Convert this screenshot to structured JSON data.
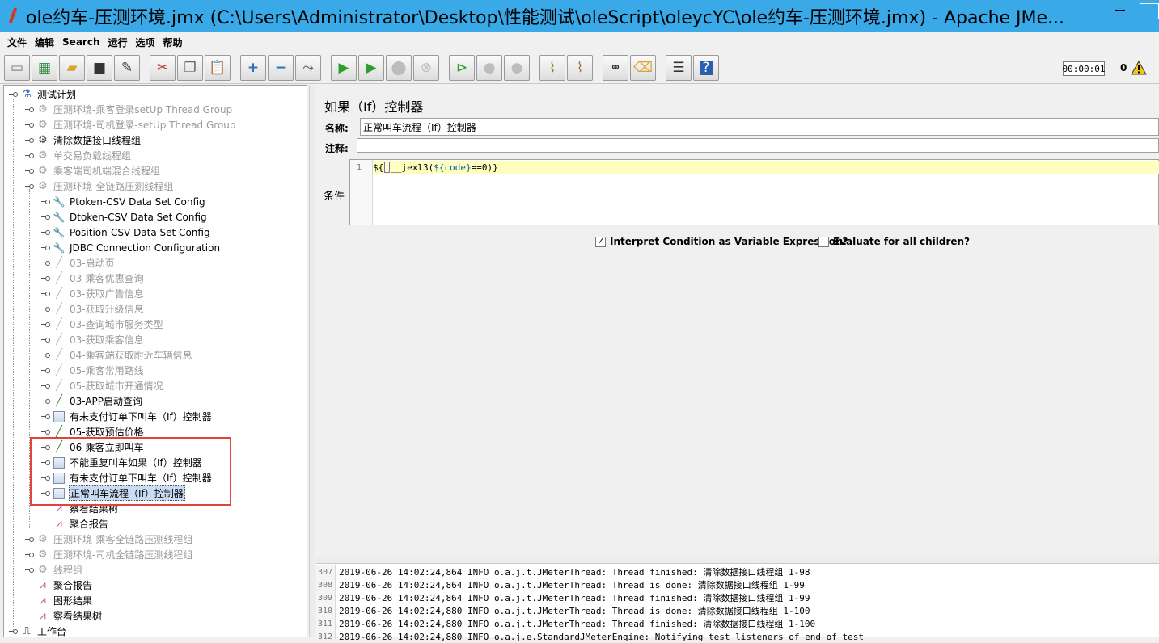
{
  "window": {
    "title": "ole约车-压测环境.jmx (C:\\Users\\Administrator\\Desktop\\性能测试\\oleScript\\oleycYC\\ole约车-压测环境.jmx) - Apache JMe..."
  },
  "menu": [
    "文件",
    "编辑",
    "Search",
    "运行",
    "选项",
    "帮助"
  ],
  "toolbar": {
    "icons": [
      "new-icon",
      "templates-icon",
      "open-icon",
      "save-icon",
      "save-as-icon",
      "cut-icon",
      "copy-icon",
      "paste-icon",
      "expand-icon",
      "collapse-icon",
      "toggle-icon",
      "start-icon",
      "start-no-pause-icon",
      "stop-icon",
      "shutdown-icon",
      "remote-start-icon",
      "remote-stop-icon",
      "remote-shutdown-icon",
      "clear-icon",
      "clear-all-icon",
      "search-icon",
      "reset-search-icon",
      "function-helper-icon",
      "help-icon"
    ],
    "timer": "00:00:01",
    "error_count": "0"
  },
  "tree": {
    "items": [
      {
        "label": "测试计划",
        "level": 0
      },
      {
        "label": "压测环境-乘客登录setUp Thread Group",
        "level": 1
      },
      {
        "label": "压测环境-司机登录-setUp Thread Group",
        "level": 1
      },
      {
        "label": "清除数据接口线程组",
        "level": 1
      },
      {
        "label": "单交易负载线程组",
        "level": 1
      },
      {
        "label": "乘客端司机端混合线程组",
        "level": 1
      },
      {
        "label": "压测环境-全链路压测线程组",
        "level": 1
      },
      {
        "label": "Ptoken-CSV Data Set Config",
        "level": 2
      },
      {
        "label": "Dtoken-CSV Data Set Config",
        "level": 2
      },
      {
        "label": "Position-CSV Data Set Config",
        "level": 2
      },
      {
        "label": "JDBC Connection Configuration",
        "level": 2
      },
      {
        "label": "03-启动页",
        "level": 2
      },
      {
        "label": "03-乘客优惠查询",
        "level": 2
      },
      {
        "label": "03-获取广告信息",
        "level": 2
      },
      {
        "label": "03-获取升级信息",
        "level": 2
      },
      {
        "label": "03-查询城市服务类型",
        "level": 2
      },
      {
        "label": "03-获取乘客信息",
        "level": 2
      },
      {
        "label": "04-乘客端获取附近车辆信息",
        "level": 2
      },
      {
        "label": "05-乘客常用路线",
        "level": 2
      },
      {
        "label": "05-获取城市开通情况",
        "level": 2
      },
      {
        "label": "03-APP启动查询",
        "level": 2
      },
      {
        "label": "有未支付订单下叫车（If）控制器",
        "level": 2
      },
      {
        "label": "05-获取预估价格",
        "level": 2
      },
      {
        "label": "06-乘客立即叫车",
        "level": 2
      },
      {
        "label": "不能重复叫车如果（If）控制器",
        "level": 2
      },
      {
        "label": "有未支付订单下叫车（If）控制器",
        "level": 2
      },
      {
        "label": "正常叫车流程（If）控制器",
        "level": 2
      },
      {
        "label": "察看结果树",
        "level": 2
      },
      {
        "label": "聚合报告",
        "level": 2
      },
      {
        "label": "压测环境-乘客全链路压测线程组",
        "level": 1
      },
      {
        "label": "压测环境-司机全链路压测线程组",
        "level": 1
      },
      {
        "label": "线程组",
        "level": 1
      },
      {
        "label": "聚合报告",
        "level": 1
      },
      {
        "label": "图形结果",
        "level": 1
      },
      {
        "label": "察看结果树",
        "level": 1
      },
      {
        "label": "工作台",
        "level": 0
      }
    ]
  },
  "editor": {
    "title": "如果（If）控制器",
    "name_label": "名称:",
    "name_value": "正常叫车流程（If）控制器",
    "comment_label": "注释:",
    "comment_value": "",
    "condition_label": "条件",
    "condition_line_no": "1",
    "condition_prefix": "${",
    "condition_func": "__jexl3(",
    "condition_var": "${code}",
    "condition_suffix": "==0)}",
    "interpret_label": "Interpret Condition as Variable Expression?",
    "interpret_checked": true,
    "evaluate_label": "Evaluate for all children?",
    "evaluate_checked": false
  },
  "log": [
    {
      "no": "307",
      "text": "2019-06-26 14:02:24,864 INFO o.a.j.t.JMeterThread: Thread finished: 清除数据接口线程组 1-98"
    },
    {
      "no": "308",
      "text": "2019-06-26 14:02:24,864 INFO o.a.j.t.JMeterThread: Thread is done: 清除数据接口线程组 1-99"
    },
    {
      "no": "309",
      "text": "2019-06-26 14:02:24,864 INFO o.a.j.t.JMeterThread: Thread finished: 清除数据接口线程组 1-99"
    },
    {
      "no": "310",
      "text": "2019-06-26 14:02:24,880 INFO o.a.j.t.JMeterThread: Thread is done: 清除数据接口线程组 1-100"
    },
    {
      "no": "311",
      "text": "2019-06-26 14:02:24,880 INFO o.a.j.t.JMeterThread: Thread finished: 清除数据接口线程组 1-100"
    },
    {
      "no": "312",
      "text": "2019-06-26 14:02:24,880 INFO o.a.j.e.StandardJMeterEngine: Notifying test listeners of end of test"
    }
  ]
}
